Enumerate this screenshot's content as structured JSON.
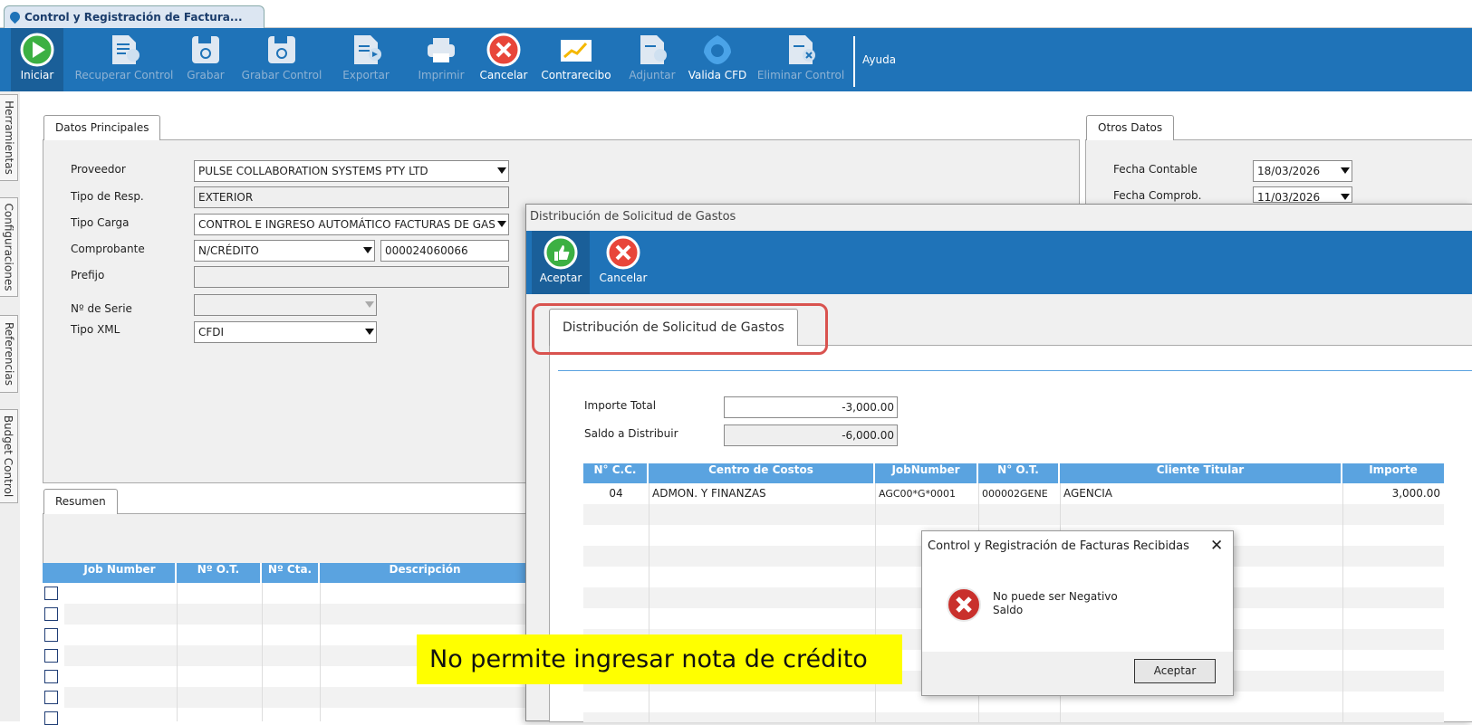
{
  "window_tab": {
    "title": "Control y Registración de Factura..."
  },
  "toolbar": {
    "buttons": [
      {
        "label": "Iniciar"
      },
      {
        "label": "Recuperar Control"
      },
      {
        "label": "Grabar"
      },
      {
        "label": "Grabar Control"
      },
      {
        "label": "Exportar"
      },
      {
        "label": "Imprimir"
      },
      {
        "label": "Cancelar"
      },
      {
        "label": "Contrarecibo"
      },
      {
        "label": "Adjuntar"
      },
      {
        "label": "Valida CFD"
      },
      {
        "label": "Eliminar Control"
      }
    ],
    "help_label": "Ayuda"
  },
  "side_tabs": [
    "Herramientas",
    "Configuraciones",
    "Referencias",
    "Budget Control"
  ],
  "datos_principales": {
    "tab_label": "Datos Principales",
    "proveedor_label": "Proveedor",
    "proveedor_value": "PULSE COLLABORATION SYSTEMS PTY LTD",
    "tipo_resp_label": "Tipo de Resp.",
    "tipo_resp_value": "EXTERIOR",
    "tipo_carga_label": "Tipo Carga",
    "tipo_carga_value": "CONTROL E INGRESO AUTOMÁTICO FACTURAS DE GAS",
    "comprobante_label": "Comprobante",
    "comprobante_type": "N/CRÉDITO",
    "comprobante_number": "000024060066",
    "prefijo_label": "Prefijo",
    "prefijo_value": "",
    "serie_label": "Nº de Serie",
    "serie_value": "",
    "tipo_xml_label": "Tipo XML",
    "tipo_xml_value": "CFDI"
  },
  "otros_datos": {
    "tab_label": "Otros Datos",
    "fecha_contable_label": "Fecha Contable",
    "fecha_contable_value": "18/03/2026",
    "fecha_comprob_label": "Fecha Comprob.",
    "fecha_comprob_value": "11/03/2026"
  },
  "resumen": {
    "tab_label": "Resumen",
    "columns": [
      "Job Number",
      "Nº O.T.",
      "Nº Cta.",
      "Descripción"
    ]
  },
  "distribucion_dialog": {
    "title": "Distribución de Solicitud de Gastos",
    "accept_label": "Aceptar",
    "cancel_label": "Cancelar",
    "tab_label": "Distribución de Solicitud de Gastos",
    "importe_total_label": "Importe Total",
    "importe_total_value": "-3,000.00",
    "saldo_label": "Saldo a Distribuir",
    "saldo_value": "-6,000.00",
    "columns": [
      "N° C.C.",
      "Centro de Costos",
      "JobNumber",
      "N° O.T.",
      "Cliente Titular",
      "Importe"
    ],
    "rows": [
      {
        "cc": "04",
        "centro": "ADMON. Y FINANZAS",
        "job": "AGC00*G*0001",
        "ot": "000002GENE",
        "cliente": "AGENCIA",
        "importe": "3,000.00"
      }
    ]
  },
  "error_dialog": {
    "title": "Control y Registración de Facturas Recibidas",
    "close_symbol": "✕",
    "message_line1": "No puede ser Negativo",
    "message_line2": "Saldo",
    "button_label": "Aceptar"
  },
  "annotation": {
    "text": "No permite ingresar nota de crédito",
    "color": "#ffff00"
  },
  "colors": {
    "toolbar_blue": "#1f73b8",
    "grid_header": "#5aa3e0",
    "highlight_red": "#d9534f"
  }
}
